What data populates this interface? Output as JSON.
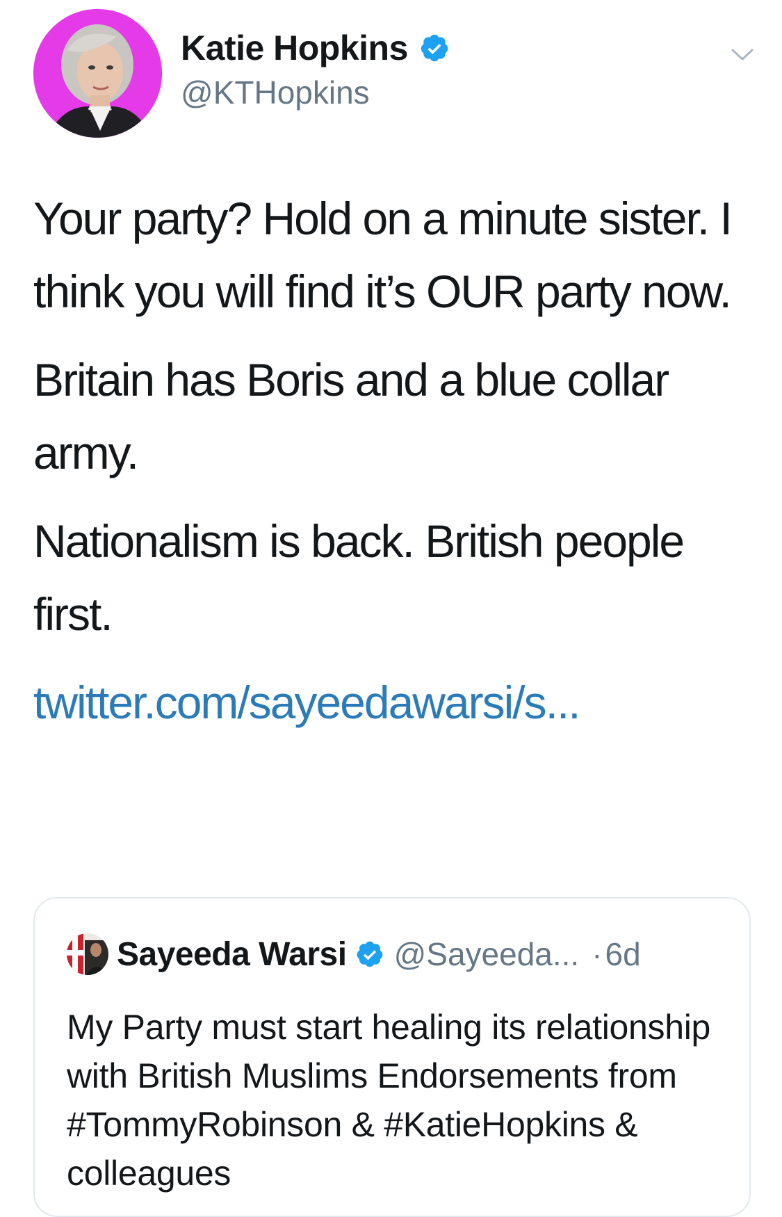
{
  "tweet": {
    "author_name": "Katie Hopkins",
    "author_handle": "@KTHopkins",
    "verified": true,
    "paragraphs": [
      "Your party? Hold on a minute sister. I think you will find it’s OUR party now.",
      "Britain has Boris and a blue collar army.",
      "Nationalism is back. British people first."
    ],
    "link_text": "twitter.com/sayeedawarsi/s...",
    "icons": {
      "verified": "verified-badge-icon",
      "menu": "chevron-down-icon"
    }
  },
  "quoted_tweet": {
    "author_name": "Sayeeda Warsi",
    "author_handle": "@Sayeeda...",
    "separator": "·",
    "time": "6d",
    "verified": true,
    "text": "My Party must start healing its relationship with British Muslims Endorsements from #TommyRobinson & #KatieHopkins & colleagues"
  },
  "colors": {
    "link": "#2b7bb9",
    "verified": "#1da1f2",
    "secondary_text": "#657786",
    "border": "#e1e8ed",
    "avatar_background": "#e43ae8"
  }
}
